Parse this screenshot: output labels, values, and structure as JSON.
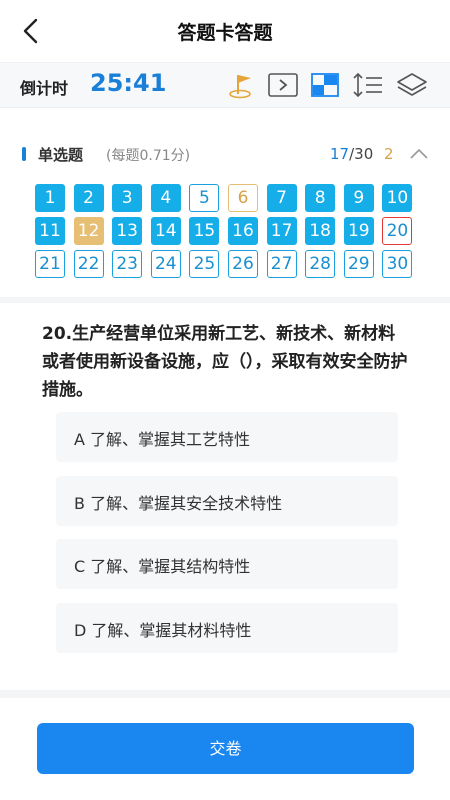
{
  "header": {
    "title": "答题卡答题"
  },
  "toolbar": {
    "timer_label": "倒计时",
    "timer_value": "25:41",
    "icons": [
      "flag-icon",
      "next-icon",
      "grid-view-icon",
      "line-spacing-icon",
      "layers-icon"
    ]
  },
  "section": {
    "title": "单选题",
    "subtitle": "(每题0.71分)",
    "progress_current": "17",
    "progress_total": "/30",
    "flag_count": "2",
    "questions": [
      {
        "n": "1",
        "state": "answered"
      },
      {
        "n": "2",
        "state": "answered"
      },
      {
        "n": "3",
        "state": "answered"
      },
      {
        "n": "4",
        "state": "answered"
      },
      {
        "n": "5",
        "state": "blank"
      },
      {
        "n": "6",
        "state": "flagged-blank"
      },
      {
        "n": "7",
        "state": "answered"
      },
      {
        "n": "8",
        "state": "answered"
      },
      {
        "n": "9",
        "state": "answered"
      },
      {
        "n": "10",
        "state": "answered"
      },
      {
        "n": "11",
        "state": "answered"
      },
      {
        "n": "12",
        "state": "flagged-answered"
      },
      {
        "n": "13",
        "state": "answered"
      },
      {
        "n": "14",
        "state": "answered"
      },
      {
        "n": "15",
        "state": "answered"
      },
      {
        "n": "16",
        "state": "answered"
      },
      {
        "n": "17",
        "state": "answered"
      },
      {
        "n": "18",
        "state": "answered"
      },
      {
        "n": "19",
        "state": "answered"
      },
      {
        "n": "20",
        "state": "current"
      },
      {
        "n": "21",
        "state": "blank"
      },
      {
        "n": "22",
        "state": "blank"
      },
      {
        "n": "23",
        "state": "blank"
      },
      {
        "n": "24",
        "state": "blank"
      },
      {
        "n": "25",
        "state": "blank"
      },
      {
        "n": "26",
        "state": "blank"
      },
      {
        "n": "27",
        "state": "blank"
      },
      {
        "n": "28",
        "state": "blank"
      },
      {
        "n": "29",
        "state": "blank"
      },
      {
        "n": "30",
        "state": "blank"
      }
    ]
  },
  "question": {
    "text": "20.生产经营单位采用新工艺、新技术、新材料或者使用新设备设施，应（），采取有效安全防护措施。",
    "options": [
      {
        "label": "A  了解、掌握其工艺特性"
      },
      {
        "label": "B  了解、掌握其安全技术特性"
      },
      {
        "label": "C  了解、掌握其结构特性"
      },
      {
        "label": "D  了解、掌握其材料特性"
      }
    ]
  },
  "footer": {
    "submit_label": "交卷"
  },
  "colors": {
    "accent": "#1a86f0",
    "answered": "#15aee8",
    "flagged": "#e6bf74",
    "current_border": "#e53935"
  }
}
